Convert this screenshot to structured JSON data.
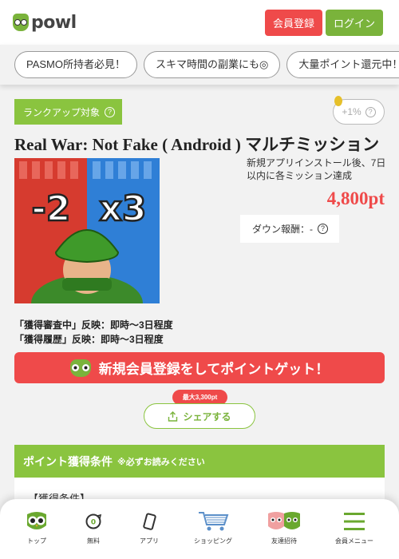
{
  "header": {
    "logo_text": "powl",
    "register_label": "会員登録",
    "login_label": "ログイン"
  },
  "chips": [
    "PASMO所持者必見！",
    "スキマ時間の副業にも◎",
    "大量ポイント還元中！"
  ],
  "offer": {
    "rank_tag": "ランクアップ対象",
    "rate_label": "+1%",
    "title": "Real War: Not Fake ( Android ) マルチミッション",
    "condition_text": "新規アプリインストール後、7日以内に各ミッション達成",
    "points": "4,800pt",
    "down_reward": "ダウン報酬：-",
    "image_text_left": "-2",
    "image_text_right": "x3",
    "reflect_lines": [
      "「獲得審査中」反映：即時～3日程度",
      "「獲得履歴」反映：即時～3日程度"
    ]
  },
  "cta": {
    "label": "新規会員登録をしてポイントゲット！"
  },
  "share": {
    "badge": "最大3,300pt",
    "label": "シェアする"
  },
  "conditions_section": {
    "title": "ポイント獲得条件",
    "note": "※必ずお読みください",
    "first_line": "【獲得条件】"
  },
  "bottom_nav": [
    {
      "label": "トップ",
      "icon": "owl-icon"
    },
    {
      "label": "無料",
      "icon": "free-coin-icon"
    },
    {
      "label": "アプリ",
      "icon": "smartphone-icon"
    },
    {
      "label": "ショッピング",
      "icon": "cart-icon"
    },
    {
      "label": "友達招待",
      "icon": "invite-friends-icon"
    },
    {
      "label": "会員メニュー",
      "icon": "hamburger-menu-icon"
    }
  ],
  "colors": {
    "brand_green": "#8ac43f",
    "accent_red": "#ef4a4a",
    "background": "#f2f2f2"
  }
}
